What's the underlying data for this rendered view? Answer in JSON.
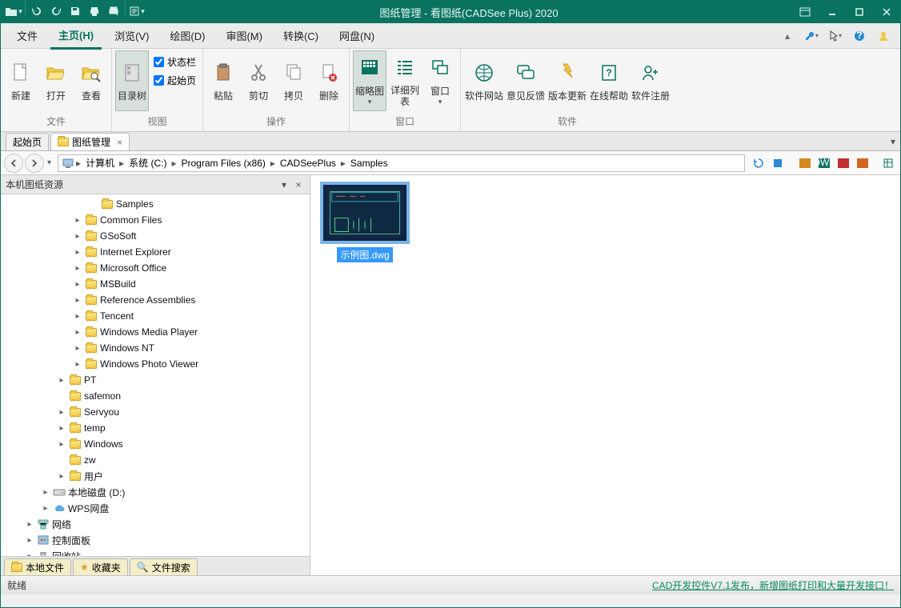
{
  "title": "图纸管理 - 看图纸(CADSee Plus) 2020",
  "menu": {
    "items": [
      "文件",
      "主页(H)",
      "浏览(V)",
      "绘图(D)",
      "审图(M)",
      "转换(C)",
      "网盘(N)"
    ],
    "active_index": 1
  },
  "ribbon": {
    "groups": [
      {
        "label": "文件",
        "buttons": [
          "新建",
          "打开",
          "查看"
        ]
      },
      {
        "label": "视图",
        "buttons": [
          "目录树"
        ],
        "checks": [
          "状态栏",
          "起始页"
        ]
      },
      {
        "label": "操作",
        "buttons": [
          "粘贴",
          "剪切",
          "拷贝",
          "删除"
        ]
      },
      {
        "label": "窗口",
        "buttons": [
          "缩略图",
          "详细列表",
          "窗口"
        ]
      },
      {
        "label": "软件",
        "buttons": [
          "软件网站",
          "意见反馈",
          "版本更新",
          "在线帮助",
          "软件注册"
        ]
      }
    ]
  },
  "tabs": {
    "start": "起始页",
    "active": "图纸管理"
  },
  "breadcrumb": [
    "计算机",
    "系统 (C:)",
    "Program Files (x86)",
    "CADSeePlus",
    "Samples"
  ],
  "sidepanel": {
    "title": "本机图纸资源",
    "tree": [
      {
        "indent": 110,
        "exp": "",
        "icon": "folder",
        "label": "Samples"
      },
      {
        "indent": 90,
        "exp": "▸",
        "icon": "folder",
        "label": "Common Files"
      },
      {
        "indent": 90,
        "exp": "▸",
        "icon": "folder",
        "label": "GSoSoft"
      },
      {
        "indent": 90,
        "exp": "▸",
        "icon": "folder",
        "label": "Internet Explorer"
      },
      {
        "indent": 90,
        "exp": "▸",
        "icon": "folder",
        "label": "Microsoft Office"
      },
      {
        "indent": 90,
        "exp": "▸",
        "icon": "folder",
        "label": "MSBuild"
      },
      {
        "indent": 90,
        "exp": "▸",
        "icon": "folder",
        "label": "Reference Assemblies"
      },
      {
        "indent": 90,
        "exp": "▸",
        "icon": "folder",
        "label": "Tencent"
      },
      {
        "indent": 90,
        "exp": "▸",
        "icon": "folder",
        "label": "Windows Media Player"
      },
      {
        "indent": 90,
        "exp": "▸",
        "icon": "folder",
        "label": "Windows NT"
      },
      {
        "indent": 90,
        "exp": "▸",
        "icon": "folder",
        "label": "Windows Photo Viewer"
      },
      {
        "indent": 70,
        "exp": "▸",
        "icon": "folder",
        "label": "PT"
      },
      {
        "indent": 70,
        "exp": "",
        "icon": "folder",
        "label": "safemon"
      },
      {
        "indent": 70,
        "exp": "▸",
        "icon": "folder",
        "label": "Servyou"
      },
      {
        "indent": 70,
        "exp": "▸",
        "icon": "folder",
        "label": "temp"
      },
      {
        "indent": 70,
        "exp": "▸",
        "icon": "folder",
        "label": "Windows"
      },
      {
        "indent": 70,
        "exp": "",
        "icon": "folder",
        "label": "zw"
      },
      {
        "indent": 70,
        "exp": "▸",
        "icon": "folder",
        "label": "用户"
      },
      {
        "indent": 50,
        "exp": "▸",
        "icon": "drive",
        "label": "本地磁盘 (D:)"
      },
      {
        "indent": 50,
        "exp": "▸",
        "icon": "cloud",
        "label": "WPS网盘"
      },
      {
        "indent": 30,
        "exp": "▸",
        "icon": "network",
        "label": "网络"
      },
      {
        "indent": 30,
        "exp": "▸",
        "icon": "control",
        "label": "控制面板"
      },
      {
        "indent": 30,
        "exp": "▸",
        "icon": "recycle",
        "label": "回收站"
      }
    ],
    "bottom_tabs": [
      "本地文件",
      "收藏夹",
      "文件搜索"
    ]
  },
  "files": [
    {
      "name": "示例图.dwg"
    }
  ],
  "status": {
    "left": "就绪",
    "link": "CAD开发控件V7.1发布，新增图纸打印和大量开发接口！"
  }
}
